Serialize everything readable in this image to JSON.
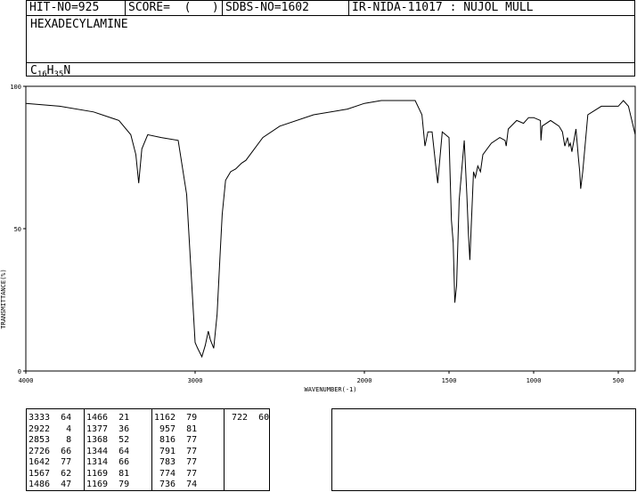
{
  "header": {
    "hit_no": "HIT-NO=925",
    "score": "SCORE=  (   )",
    "sdbs_no": "SDBS-NO=1602",
    "ir_info": "IR-NIDA-11017 : NUJOL MULL",
    "compound_name": "HEXADECYLAMINE",
    "formula": {
      "c": "C",
      "c_count": "16",
      "h": "H",
      "h_count": "35",
      "n": "N"
    }
  },
  "chart_data": {
    "type": "line",
    "title": "",
    "xlabel": "WAVENUMBER(-1)",
    "ylabel": "TRANSMITTANCE(%)",
    "xlim": [
      4000,
      400
    ],
    "ylim": [
      0,
      100
    ],
    "x_ticks": [
      4000,
      3000,
      2000,
      1500,
      1000,
      500
    ],
    "y_ticks": [
      0,
      50,
      100
    ],
    "x": [
      4000,
      3800,
      3600,
      3450,
      3380,
      3350,
      3333,
      3315,
      3280,
      3200,
      3100,
      3050,
      3000,
      2985,
      2960,
      2940,
      2922,
      2910,
      2890,
      2870,
      2853,
      2840,
      2820,
      2790,
      2760,
      2726,
      2700,
      2600,
      2500,
      2300,
      2100,
      2000,
      1900,
      1800,
      1700,
      1660,
      1642,
      1625,
      1600,
      1580,
      1567,
      1540,
      1500,
      1486,
      1475,
      1466,
      1455,
      1440,
      1410,
      1395,
      1385,
      1377,
      1368,
      1355,
      1344,
      1330,
      1314,
      1300,
      1250,
      1200,
      1169,
      1162,
      1150,
      1100,
      1060,
      1030,
      1000,
      960,
      957,
      950,
      900,
      850,
      830,
      816,
      800,
      791,
      783,
      774,
      750,
      736,
      728,
      722,
      710,
      680,
      600,
      500,
      470,
      440,
      400
    ],
    "y": [
      94,
      93,
      91,
      88,
      83,
      76,
      66,
      78,
      83,
      82,
      81,
      62,
      10,
      8,
      5,
      9,
      14,
      11,
      8,
      20,
      40,
      55,
      67,
      70,
      71,
      73,
      74,
      82,
      86,
      90,
      92,
      94,
      95,
      95,
      95,
      90,
      79,
      84,
      84,
      73,
      66,
      84,
      82,
      53,
      45,
      24,
      30,
      60,
      81,
      62,
      48,
      39,
      52,
      70,
      68,
      72,
      70,
      76,
      80,
      82,
      81,
      79,
      85,
      88,
      87,
      89,
      89,
      88,
      81,
      86,
      88,
      86,
      84,
      79,
      82,
      79,
      80,
      77,
      85,
      75,
      70,
      64,
      70,
      90,
      93,
      93,
      95,
      93,
      83
    ]
  },
  "peak_table": [
    [
      3333,
      64
    ],
    [
      2922,
      4
    ],
    [
      2853,
      8
    ],
    [
      2726,
      66
    ],
    [
      1642,
      77
    ],
    [
      1567,
      62
    ],
    [
      1486,
      47
    ],
    [
      1466,
      21
    ],
    [
      1377,
      36
    ],
    [
      1368,
      52
    ],
    [
      1344,
      64
    ],
    [
      1314,
      66
    ],
    [
      1169,
      81
    ],
    [
      1169,
      79
    ],
    [
      1162,
      79
    ],
    [
      957,
      81
    ],
    [
      816,
      77
    ],
    [
      791,
      77
    ],
    [
      783,
      77
    ],
    [
      774,
      77
    ],
    [
      736,
      74
    ],
    [
      722,
      60
    ]
  ]
}
